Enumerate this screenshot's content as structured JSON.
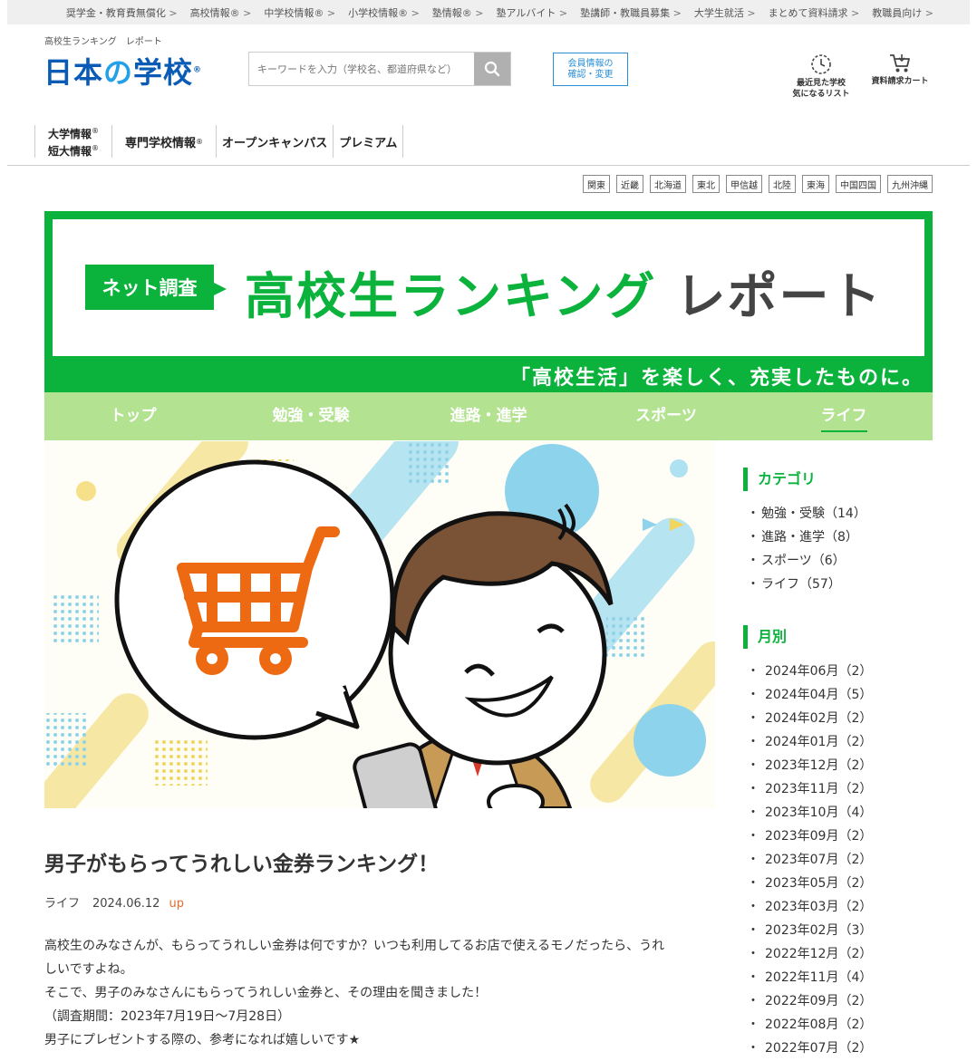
{
  "util_nav": [
    "奨学金・教育費無償化",
    "高校情報®",
    "中学校情報®",
    "小学校情報®",
    "塾情報®",
    "塾アルバイト",
    "塾講師・教職員募集",
    "大学生就活",
    "まとめて資料請求",
    "教職員向け"
  ],
  "header": {
    "site_sub": "高校生ランキング　レポート",
    "logo_a": "日本",
    "logo_b": "の",
    "logo_c": "学校",
    "logo_mark": "®",
    "search_placeholder": "キーワードを入力（学校名、都道府県など）",
    "member_line1": "会員情報の",
    "member_line2": "確認・変更",
    "recent_line1": "最近見た学校",
    "recent_line2": "気になるリスト",
    "cart_label": "資料請求カート"
  },
  "gnav": {
    "univ1": "大学情報",
    "univ2": "短大情報",
    "mark": "®",
    "senmon": "専門学校情報",
    "open_campus": "オープンキャンパス",
    "premium": "プレミアム"
  },
  "regions": [
    "関東",
    "近畿",
    "北海道",
    "東北",
    "甲信越",
    "北陸",
    "東海",
    "中国四国",
    "九州沖縄"
  ],
  "banner": {
    "badge": "ネット調査",
    "title": "高校生ランキング",
    "title_suffix": "レポート",
    "tagline": "「高校生活」を楽しく、充実したものに。"
  },
  "category_nav": [
    "トップ",
    "勉強・受験",
    "進路・進学",
    "スポーツ",
    "ライフ"
  ],
  "category_nav_active": "ライフ",
  "article": {
    "title": "男子がもらってうれしい金券ランキング！",
    "category": "ライフ",
    "date": "2024.06.12",
    "up_label": "up",
    "body": [
      "高校生のみなさんが、もらってうれしい金券は何ですか？いつも利用してるお店で使えるモノだったら、うれ",
      "しいですよね。",
      "そこで、男子のみなさんにもらってうれしい金券と、その理由を聞きました！",
      "（調査期間：2023年7月19日～7月28日）",
      "男子にプレゼントする際の、参考になれば嬉しいです★"
    ]
  },
  "sidebar": {
    "category_heading": "カテゴリ",
    "categories": [
      "勉強・受験（14）",
      "進路・進学（8）",
      "スポーツ（6）",
      "ライフ（57）"
    ],
    "monthly_heading": "月別",
    "months": [
      "2024年06月（2）",
      "2024年04月（5）",
      "2024年02月（2）",
      "2024年01月（2）",
      "2023年12月（2）",
      "2023年11月（2）",
      "2023年10月（4）",
      "2023年09月（2）",
      "2023年07月（2）",
      "2023年05月（2）",
      "2023年03月（2）",
      "2023年02月（3）",
      "2022年12月（2）",
      "2022年11月（4）",
      "2022年09月（2）",
      "2022年08月（2）",
      "2022年07月（2）"
    ]
  },
  "colors": {
    "brand_green": "#0bb33c",
    "nav_green": "#b3e391",
    "logo_blue": "#0a5bb5",
    "up_orange": "#e46a2c"
  }
}
